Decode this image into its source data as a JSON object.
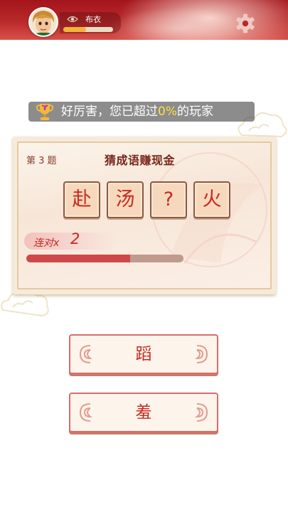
{
  "header": {
    "rank_name": "布衣",
    "xp_fraction": 0.45,
    "avatar_icon": "player-avatar-icon",
    "rank_icon": "eye-rank-icon",
    "settings_icon": "gear-icon"
  },
  "banner": {
    "prefix": "好厉害，您已超过",
    "percent": "0%",
    "suffix": "的玩家",
    "icon": "trophy-icon"
  },
  "question": {
    "number_label": "第 3 题",
    "title": "猜成语赚现金",
    "tiles": [
      "赴",
      "汤",
      "?",
      "火"
    ],
    "combo_label": "连对x",
    "combo_count": "2",
    "timer_fraction": 0.66
  },
  "answers": [
    "蹈",
    "羞"
  ],
  "colors": {
    "accent_red": "#c8281e",
    "header_red": "#b92a2a",
    "card_bg": "#f6ead9",
    "banner_highlight": "#ffe03a"
  }
}
